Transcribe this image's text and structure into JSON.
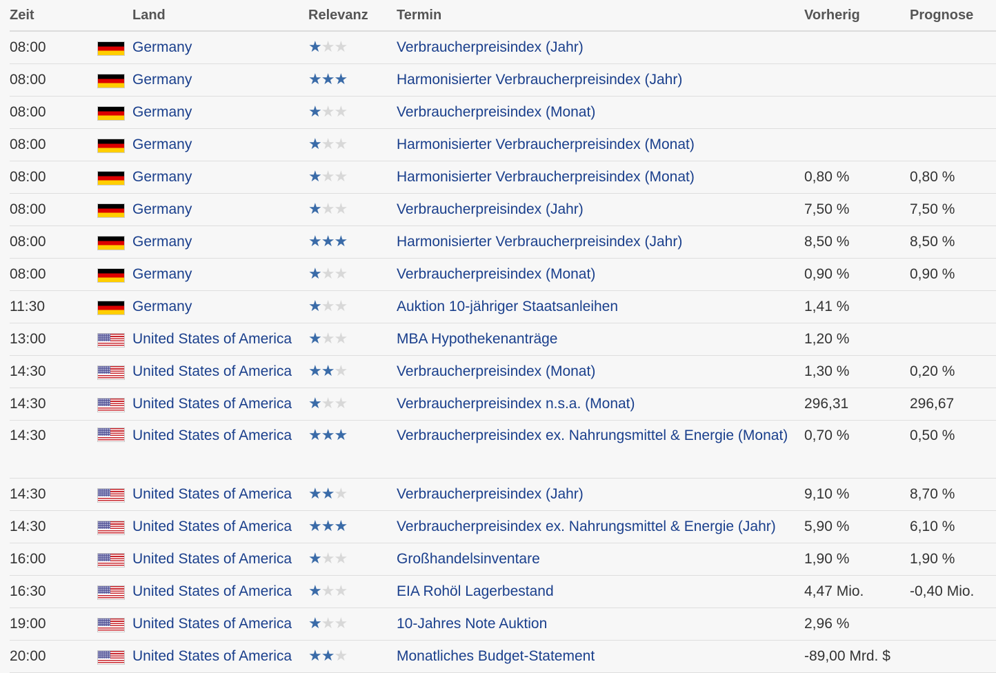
{
  "headers": {
    "zeit": "Zeit",
    "land": "Land",
    "relevanz": "Relevanz",
    "termin": "Termin",
    "vorherig": "Vorherig",
    "prognose": "Prognose"
  },
  "colors": {
    "star_active": "#3a6ba8",
    "star_inactive": "#d8d8d8",
    "link": "#1a3f8c"
  },
  "rows": [
    {
      "time": "08:00",
      "flag": "germany-flag",
      "country": "Germany",
      "relevance": 1,
      "event": "Verbraucherpreisindex (Jahr)",
      "previous": "",
      "forecast": ""
    },
    {
      "time": "08:00",
      "flag": "germany-flag",
      "country": "Germany",
      "relevance": 3,
      "event": "Harmonisierter Verbraucherpreisindex (Jahr)",
      "previous": "",
      "forecast": ""
    },
    {
      "time": "08:00",
      "flag": "germany-flag",
      "country": "Germany",
      "relevance": 1,
      "event": "Verbraucherpreisindex (Monat)",
      "previous": "",
      "forecast": ""
    },
    {
      "time": "08:00",
      "flag": "germany-flag",
      "country": "Germany",
      "relevance": 1,
      "event": "Harmonisierter Verbraucherpreisindex (Monat)",
      "previous": "",
      "forecast": ""
    },
    {
      "time": "08:00",
      "flag": "germany-flag",
      "country": "Germany",
      "relevance": 1,
      "event": "Harmonisierter Verbraucherpreisindex (Monat)",
      "previous": "0,80 %",
      "forecast": "0,80 %"
    },
    {
      "time": "08:00",
      "flag": "germany-flag",
      "country": "Germany",
      "relevance": 1,
      "event": "Verbraucherpreisindex (Jahr)",
      "previous": "7,50 %",
      "forecast": "7,50 %"
    },
    {
      "time": "08:00",
      "flag": "germany-flag",
      "country": "Germany",
      "relevance": 3,
      "event": "Harmonisierter Verbraucherpreisindex (Jahr)",
      "previous": "8,50 %",
      "forecast": "8,50 %"
    },
    {
      "time": "08:00",
      "flag": "germany-flag",
      "country": "Germany",
      "relevance": 1,
      "event": "Verbraucherpreisindex (Monat)",
      "previous": "0,90 %",
      "forecast": "0,90 %"
    },
    {
      "time": "11:30",
      "flag": "germany-flag",
      "country": "Germany",
      "relevance": 1,
      "event": "Auktion 10-jähriger Staatsanleihen",
      "previous": "1,41 %",
      "forecast": ""
    },
    {
      "time": "13:00",
      "flag": "usa-flag",
      "country": "United States of America",
      "relevance": 1,
      "event": "MBA Hypothekenanträge",
      "previous": "1,20 %",
      "forecast": ""
    },
    {
      "time": "14:30",
      "flag": "usa-flag",
      "country": "United States of America",
      "relevance": 2,
      "event": "Verbraucherpreisindex (Monat)",
      "previous": "1,30 %",
      "forecast": "0,20 %"
    },
    {
      "time": "14:30",
      "flag": "usa-flag",
      "country": "United States of America",
      "relevance": 1,
      "event": "Verbraucherpreisindex n.s.a. (Monat)",
      "previous": "296,31",
      "forecast": "296,67"
    },
    {
      "time": "14:30",
      "flag": "usa-flag",
      "country": "United States of America",
      "relevance": 3,
      "event": "Verbraucherpreisindex ex. Nahrungsmittel & Energie (Monat)",
      "previous": "0,70 %",
      "forecast": "0,50 %"
    },
    {
      "time": "14:30",
      "flag": "usa-flag",
      "country": "United States of America",
      "relevance": 2,
      "event": "Verbraucherpreisindex (Jahr)",
      "previous": "9,10 %",
      "forecast": "8,70 %"
    },
    {
      "time": "14:30",
      "flag": "usa-flag",
      "country": "United States of America",
      "relevance": 3,
      "event": "Verbraucherpreisindex ex. Nahrungsmittel & Energie (Jahr)",
      "previous": "5,90 %",
      "forecast": "6,10 %"
    },
    {
      "time": "16:00",
      "flag": "usa-flag",
      "country": "United States of America",
      "relevance": 1,
      "event": "Großhandelsinventare",
      "previous": "1,90 %",
      "forecast": "1,90 %"
    },
    {
      "time": "16:30",
      "flag": "usa-flag",
      "country": "United States of America",
      "relevance": 1,
      "event": "EIA Rohöl Lagerbestand",
      "previous": "4,47 Mio.",
      "forecast": "-0,40 Mio."
    },
    {
      "time": "19:00",
      "flag": "usa-flag",
      "country": "United States of America",
      "relevance": 1,
      "event": "10-Jahres Note Auktion",
      "previous": "2,96 %",
      "forecast": ""
    },
    {
      "time": "20:00",
      "flag": "usa-flag",
      "country": "United States of America",
      "relevance": 2,
      "event": "Monatliches Budget-Statement",
      "previous": "-89,00 Mrd. $",
      "forecast": ""
    }
  ]
}
